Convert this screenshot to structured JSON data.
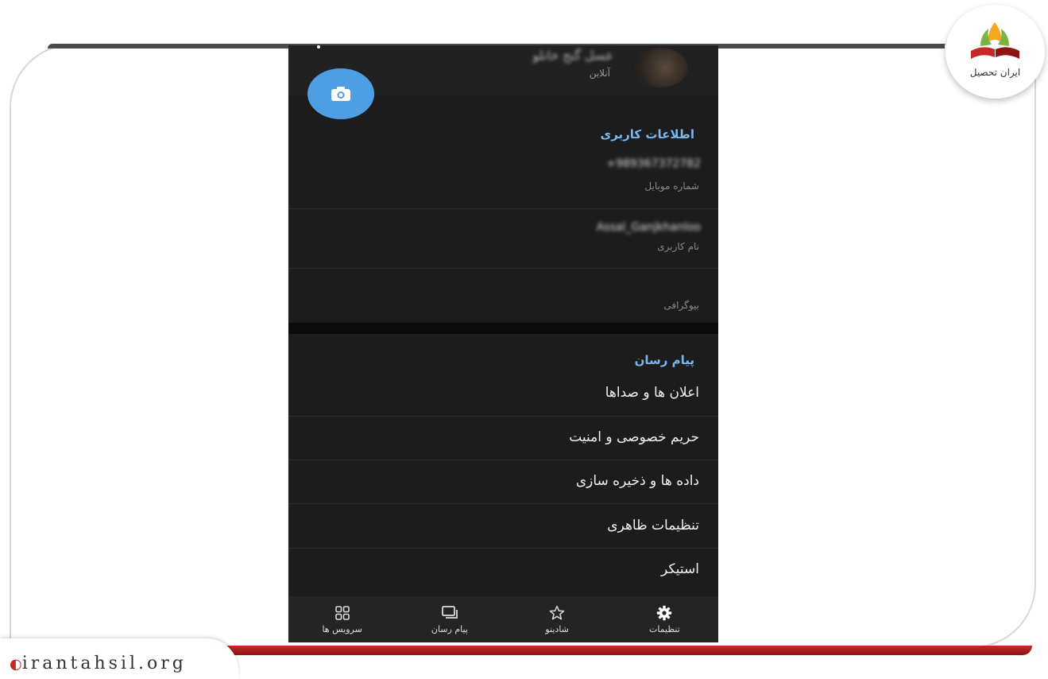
{
  "watermark": {
    "site_url": "irantahsil.org",
    "logo_text": "ایران تحصیل"
  },
  "profile": {
    "name": "عسل گنج خانلو",
    "status": "آنلاین"
  },
  "user_info": {
    "section_title": "اطلاعات کاربری",
    "phone_value": "+989367372782",
    "phone_label": "شماره موبایل",
    "username_value": "Assal_Ganjkhanloo",
    "username_label": "نام کاربری",
    "bio_label": "بیوگرافی"
  },
  "messenger": {
    "section_title": "پیام رسان",
    "items": [
      {
        "label": "اعلان ها و صداها"
      },
      {
        "label": "حریم خصوصی و امنیت"
      },
      {
        "label": "داده ها و ذخیره سازی"
      },
      {
        "label": "تنظیمات ظاهری"
      },
      {
        "label": "استیکر"
      }
    ]
  },
  "bottom_nav": {
    "tabs": [
      {
        "label": "سرویس ها",
        "icon": "grid-icon"
      },
      {
        "label": "پیام رسان",
        "icon": "chat-icon"
      },
      {
        "label": "شادینو",
        "icon": "star-icon"
      },
      {
        "label": "تنظیمات",
        "icon": "gear-icon"
      }
    ]
  },
  "colors": {
    "accent": "#7ab7ee",
    "fab": "#4e9ee3",
    "background": "#1c1c1c",
    "brand_red": "#c62828"
  }
}
